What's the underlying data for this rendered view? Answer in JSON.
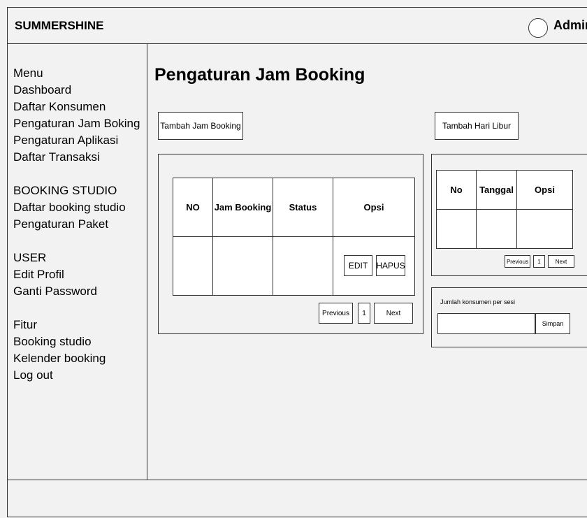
{
  "header": {
    "brand": "SUMMERSHINE",
    "user": "Admin"
  },
  "sidebar": {
    "groups": [
      {
        "items": [
          "Menu",
          "Dashboard",
          "Daftar Konsumen",
          "Pengaturan Jam Boking",
          "Pengaturan Aplikasi",
          "Daftar Transaksi"
        ]
      },
      {
        "items": [
          "BOOKING STUDIO",
          "Daftar booking studio",
          "Pengaturan Paket"
        ]
      },
      {
        "items": [
          "USER",
          "Edit Profil",
          "Ganti Password"
        ]
      },
      {
        "items": [
          "Fitur",
          "Booking studio",
          "Kelender booking",
          "Log out"
        ]
      }
    ]
  },
  "main": {
    "title": "Pengaturan Jam Booking",
    "add_booking_button": "Tambah Jam Booking",
    "add_holiday_button": "Tambah Hari Libur",
    "booking_table": {
      "headers": [
        "NO",
        "Jam Booking",
        "Status",
        "Opsi"
      ],
      "edit_label": "EDIT",
      "delete_label": "HAPUS"
    },
    "booking_pagination": {
      "prev": "Previous",
      "page": "1",
      "next": "Next"
    },
    "holiday_table": {
      "headers": [
        "No",
        "Tanggal",
        "Opsi"
      ]
    },
    "holiday_pagination": {
      "prev": "Previous",
      "page": "1",
      "next": "Next"
    },
    "session_form": {
      "label": "Jumlah konsumen per sesi",
      "value": "",
      "save_label": "Simpan"
    }
  }
}
